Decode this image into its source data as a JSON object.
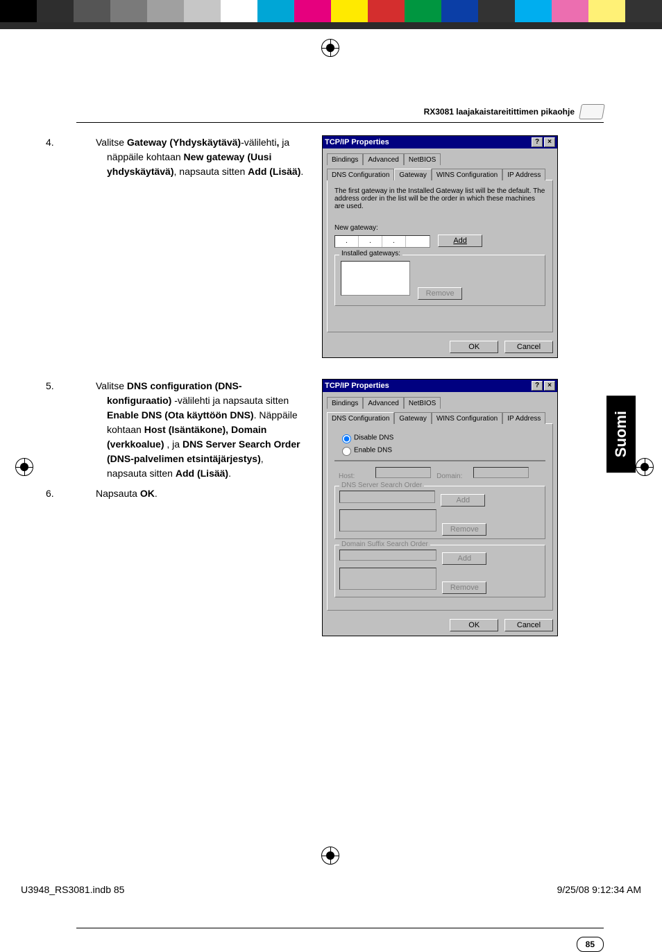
{
  "colorbar": [
    "#000000",
    "#2e2e2e",
    "#555555",
    "#7a7a7a",
    "#a0a0a0",
    "#c6c6c6",
    "#ffffff",
    "#00a6d6",
    "#e6007e",
    "#ffea00",
    "#d42e2e",
    "#009640",
    "#0b3ea6",
    "#333333",
    "#00aeef",
    "#ec6eb0",
    "#fff176",
    "#333333"
  ],
  "header": {
    "title": "RX3081 laajakaistareitittimen pikaohje"
  },
  "step4": {
    "num": "4.",
    "runs": [
      {
        "t": "Valitse ",
        "b": false
      },
      {
        "t": "Gateway (Yhdyskäytävä)",
        "b": true
      },
      {
        "t": "-välilehti",
        "b": false
      },
      {
        "t": ",",
        "b": true
      },
      {
        "t": " ja näppäile kohtaan ",
        "b": false
      },
      {
        "t": "New gateway (Uusi yhdyskäytävä)",
        "b": true
      },
      {
        "t": ", napsauta sitten ",
        "b": false
      },
      {
        "t": "Add (Lisää)",
        "b": true
      },
      {
        "t": ".",
        "b": false
      }
    ]
  },
  "step5": {
    "num": "5.",
    "runs": [
      {
        "t": "Valitse ",
        "b": false
      },
      {
        "t": "DNS configuration (DNS-konfiguraatio)",
        "b": true
      },
      {
        "t": " -välilehti ja napsauta sitten ",
        "b": false
      },
      {
        "t": "Enable DNS (Ota käyttöön DNS)",
        "b": true
      },
      {
        "t": ". Näppäile kohtaan ",
        "b": false
      },
      {
        "t": "Host (Isäntäkone), Domain (verkkoalue)",
        "b": true
      },
      {
        "t": " , ja ",
        "b": false
      },
      {
        "t": "DNS Server Search Order (DNS-palvelimen etsintäjärjestys)",
        "b": true
      },
      {
        "t": ", napsauta sitten ",
        "b": false
      },
      {
        "t": "Add (Lisää)",
        "b": true
      },
      {
        "t": ".",
        "b": false
      }
    ]
  },
  "step6": {
    "num": "6.",
    "runs": [
      {
        "t": "Napsauta ",
        "b": false
      },
      {
        "t": "OK",
        "b": true
      },
      {
        "t": ".",
        "b": false
      }
    ]
  },
  "dlg1": {
    "title": "TCP/IP Properties",
    "help": "?",
    "close": "×",
    "tabs_top": [
      "Bindings",
      "Advanced",
      "NetBIOS"
    ],
    "tabs_bot": [
      "DNS Configuration",
      "Gateway",
      "WINS Configuration",
      "IP Address"
    ],
    "active_tab": "Gateway",
    "hint": "The first gateway in the Installed Gateway list will be the default. The address order in the list will be the order in which these machines are used.",
    "new_label": "New gateway:",
    "add": "Add",
    "installed_label": "Installed gateways:",
    "remove": "Remove",
    "ok": "OK",
    "cancel": "Cancel"
  },
  "dlg2": {
    "title": "TCP/IP Properties",
    "help": "?",
    "close": "×",
    "tabs_top": [
      "Bindings",
      "Advanced",
      "NetBIOS"
    ],
    "tabs_bot": [
      "DNS Configuration",
      "Gateway",
      "WINS Configuration",
      "IP Address"
    ],
    "active_tab": "DNS Configuration",
    "radio_disable": "Disable DNS",
    "radio_enable": "Enable DNS",
    "host": "Host:",
    "domain": "Domain:",
    "dns_order": "DNS Server Search Order",
    "suffix_order": "Domain Suffix Search Order",
    "add": "Add",
    "remove": "Remove",
    "ok": "OK",
    "cancel": "Cancel"
  },
  "sidetab": "Suomi",
  "pagenum": "85",
  "footer_left": "U3948_RS3081.indb   85",
  "footer_right": "9/25/08   9:12:34 AM"
}
